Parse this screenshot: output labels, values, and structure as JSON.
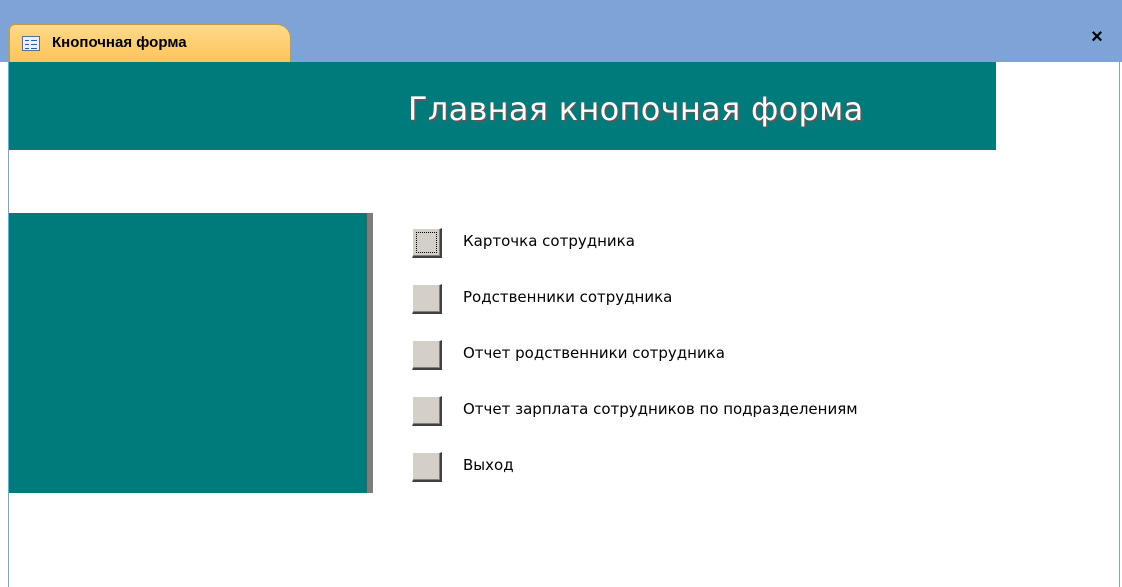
{
  "tab": {
    "title": "Кнопочная форма",
    "icon": "form-icon",
    "close_label": "×"
  },
  "form": {
    "title": "Главная кнопочная форма",
    "colors": {
      "band": "#007b7b",
      "tab_strip": "#7ea3d6",
      "tab_active": "#fbc45a"
    }
  },
  "menu": {
    "items": [
      {
        "label": "Карточка сотрудника",
        "focused": true
      },
      {
        "label": "Родственники сотрудника",
        "focused": false
      },
      {
        "label": "Отчет родственники сотрудника",
        "focused": false
      },
      {
        "label": "Отчет зарплата сотрудников по подразделениям",
        "focused": false
      },
      {
        "label": "Выход",
        "focused": false
      }
    ]
  }
}
